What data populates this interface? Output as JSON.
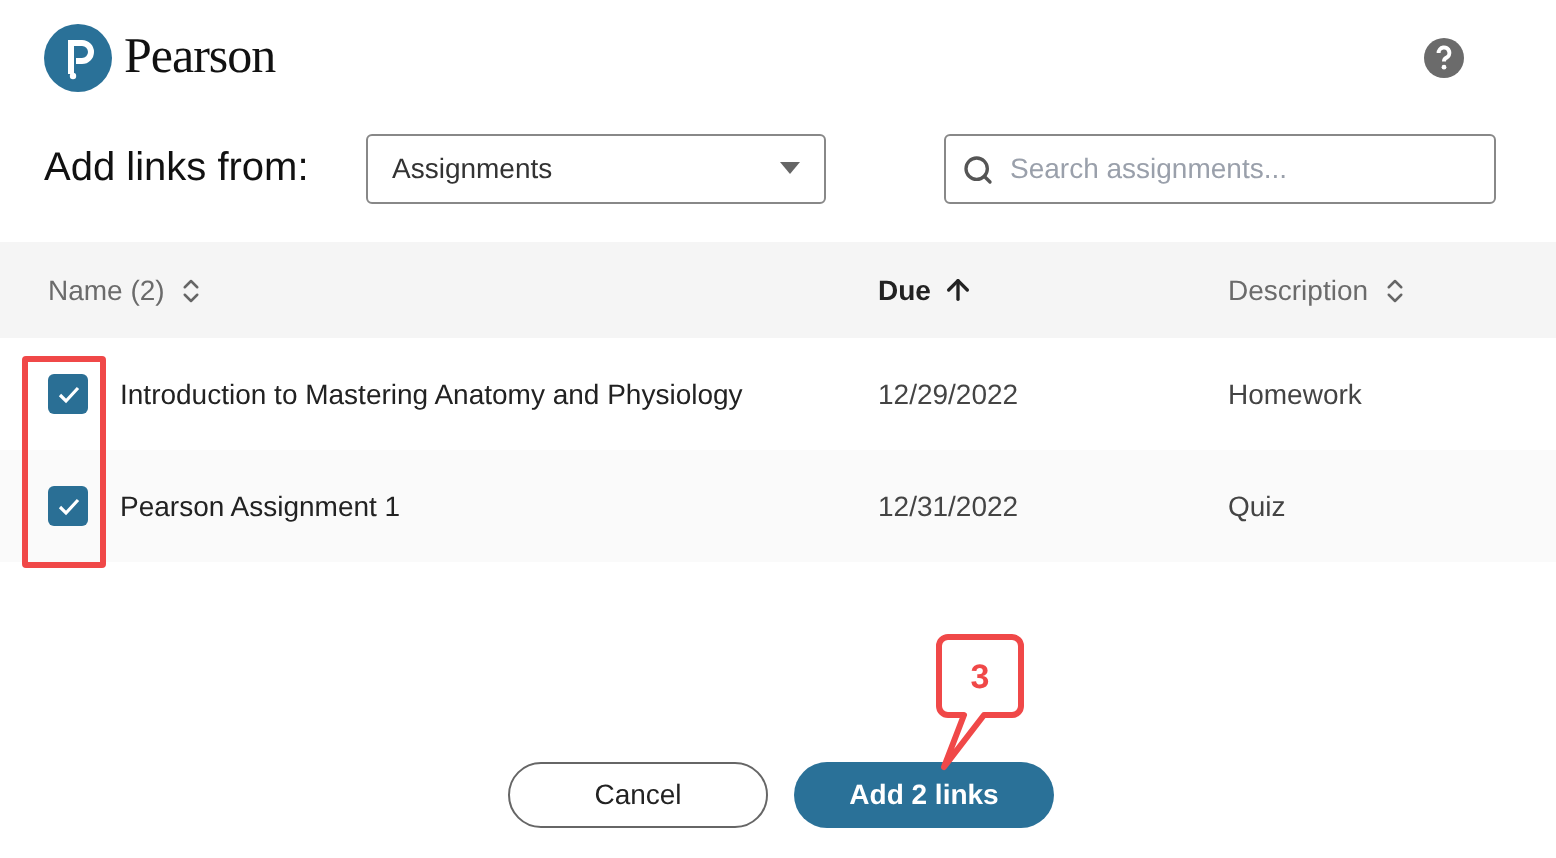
{
  "logo": {
    "name": "Pearson"
  },
  "source": {
    "label": "Add links from:",
    "value": "Assignments"
  },
  "search": {
    "placeholder": "Search assignments..."
  },
  "table": {
    "columns": [
      {
        "label": "Name (2)",
        "sorted": false
      },
      {
        "label": "Due",
        "sorted": true
      },
      {
        "label": "Description",
        "sorted": false
      }
    ],
    "rows": [
      {
        "checked": true,
        "name": "Introduction to Mastering Anatomy and Physiology",
        "due": "12/29/2022",
        "description": "Homework"
      },
      {
        "checked": true,
        "name": "Pearson Assignment 1",
        "due": "12/31/2022",
        "description": "Quiz"
      }
    ]
  },
  "callout": {
    "text": "3"
  },
  "buttons": [
    {
      "label": "Cancel",
      "kind": "secondary"
    },
    {
      "label": "Add 2 links",
      "kind": "primary"
    }
  ]
}
